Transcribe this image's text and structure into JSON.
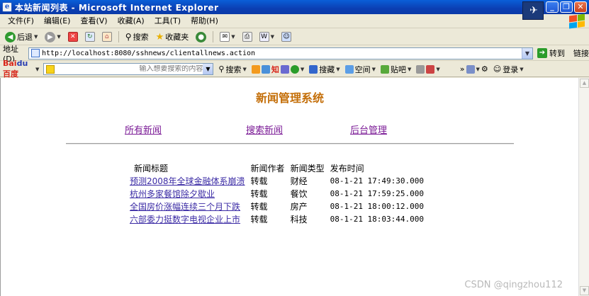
{
  "window": {
    "title": "本站新闻列表 - Microsoft Internet Explorer",
    "minimize": "_",
    "maximize": "❐",
    "close": "✕"
  },
  "menu": {
    "items": [
      "文件(F)",
      "编辑(E)",
      "查看(V)",
      "收藏(A)",
      "工具(T)",
      "帮助(H)"
    ]
  },
  "toolbar": {
    "back": "后退",
    "search": "搜索",
    "favorites": "收藏夹"
  },
  "address": {
    "label": "地址(D)",
    "url": "http://localhost:8080/sshnews/clientallnews.action",
    "go": "转到",
    "links": "链接"
  },
  "baidu": {
    "logo_red": "Bai",
    "logo_blue": "du",
    "logo_suffix": "百度",
    "placeholder": "输入想要搜索的内容",
    "search": "搜索",
    "news": "知",
    "post": "搜藏",
    "space": "空间",
    "tieba": "贴吧",
    "login": "登录"
  },
  "page": {
    "title": "新闻管理系统",
    "nav": [
      "所有新闻",
      "搜索新闻",
      "后台管理"
    ],
    "table": {
      "headers": [
        "新闻标题",
        "新闻作者",
        "新闻类型",
        "发布时间"
      ],
      "rows": [
        [
          "预测2008年全球金融体系崩溃",
          "转载",
          "财经",
          "08-1-21 17:49:30.000"
        ],
        [
          "杭州多家餐馆除夕歇业",
          "转载",
          "餐饮",
          "08-1-21 17:59:25.000"
        ],
        [
          "全国房价涨幅连续三个月下跌",
          "转载",
          "房产",
          "08-1-21 18:00:12.000"
        ],
        [
          "六部委力挺数字电视企业上市",
          "转载",
          "科技",
          "08-1-21 18:03:44.000"
        ]
      ]
    }
  },
  "watermark": "CSDN @qingzhou112",
  "colors": {
    "title_orange": "#c46f0a",
    "link_purple": "#7b1b96",
    "link_blue": "#3b2ba5"
  }
}
